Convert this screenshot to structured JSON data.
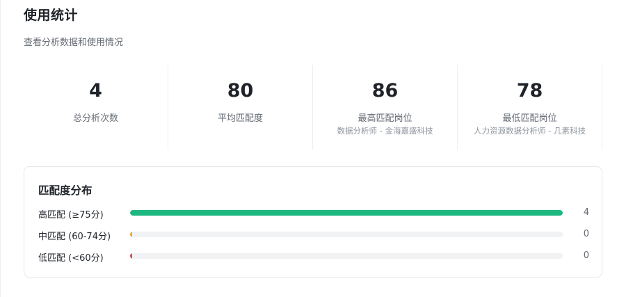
{
  "page": {
    "title": "使用统计",
    "subtitle": "查看分析数据和使用情况"
  },
  "stats": [
    {
      "value": "4",
      "label": "总分析次数",
      "note": ""
    },
    {
      "value": "80",
      "label": "平均匹配度",
      "note": ""
    },
    {
      "value": "86",
      "label": "最高匹配岗位",
      "note": "数据分析师 - 金海嘉盛科技"
    },
    {
      "value": "78",
      "label": "最低匹配岗位",
      "note": "人力资源数据分析师 - 几素科技"
    }
  ],
  "distribution": {
    "title": "匹配度分布",
    "total": 4,
    "rows": [
      {
        "label": "高匹配 (≥75分)",
        "count": 4,
        "color": "#1cb87f"
      },
      {
        "label": "中匹配 (60-74分)",
        "count": 0,
        "color": "#f5a623"
      },
      {
        "label": "低匹配 (<60分)",
        "count": 0,
        "color": "#e5484d"
      }
    ]
  }
}
